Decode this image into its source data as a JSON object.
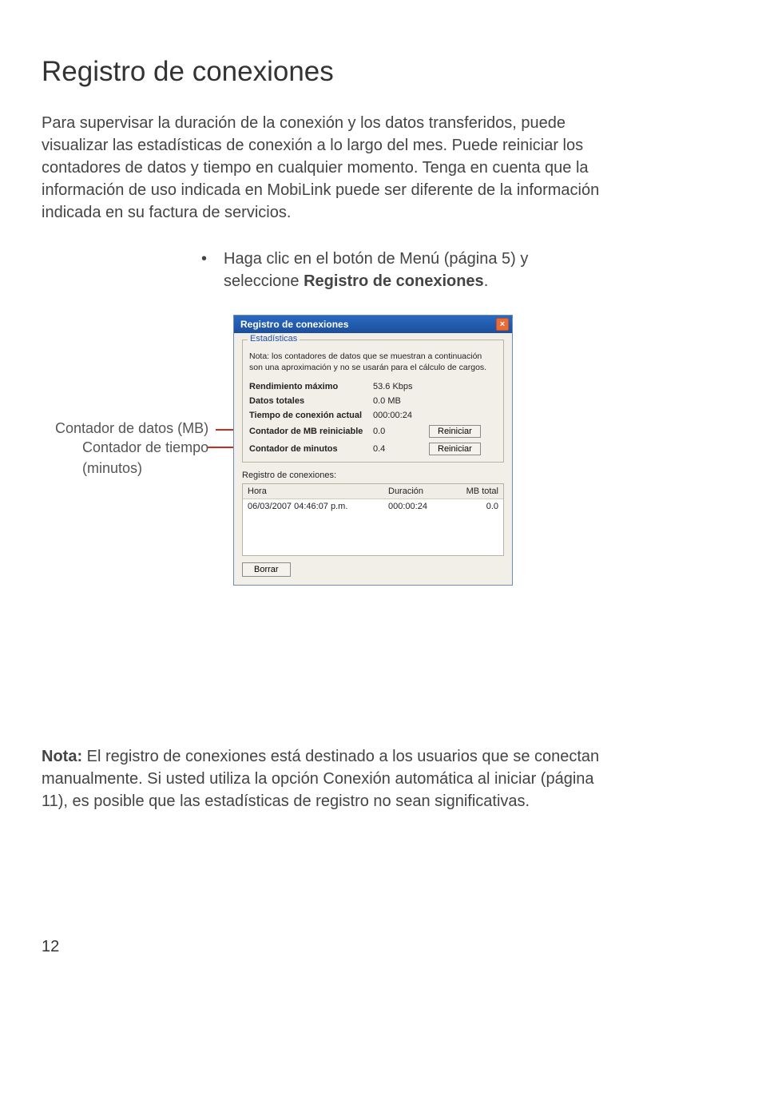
{
  "page": {
    "title": "Registro de conexiones",
    "intro": "Para supervisar la duración de la conexión y los datos transferidos, puede visualizar las estadísticas de conexión a lo largo del mes. Puede reiniciar los contadores de datos y tiempo en cualquier momento. Tenga en cuenta que la información de uso indicada en MobiLink puede ser diferente de la información indicada en su factura de servicios.",
    "bullet_prefix": "Haga clic en el botón de Menú (página 5) y seleccione ",
    "bullet_bold": "Registro de conexiones",
    "bullet_suffix": ".",
    "callout1": "Contador de datos (MB)",
    "callout2": "Contador de tiempo",
    "callout3": "(minutos)",
    "nota_label": "Nota:",
    "nota_text": " El registro de conexiones está destinado a los usuarios que se conectan manualmente. Si usted utiliza la opción Conexión automática al iniciar (página 11), es posible que las estadísticas de registro no sean significativas.",
    "page_number": "12"
  },
  "dialog": {
    "title": "Registro de conexiones",
    "close": "×",
    "group_legend": "Estadísticas",
    "note1": "Nota: los contadores de datos que se muestran a continuación",
    "note2": "son una aproximación y no se usarán para el cálculo de cargos.",
    "rows": {
      "r1_label": "Rendimiento máximo",
      "r1_value": "53.6 Kbps",
      "r2_label": "Datos totales",
      "r2_value": "0.0 MB",
      "r3_label": "Tiempo de conexión actual",
      "r3_value": "000:00:24",
      "r4_label": "Contador de MB reiniciable",
      "r4_value": "0.0",
      "r5_label": "Contador de minutos",
      "r5_value": "0.4"
    },
    "btn_reset": "Reiniciar",
    "log_label": "Registro de conexiones:",
    "cols": {
      "hora": "Hora",
      "dur": "Duración",
      "mb": "MB total"
    },
    "entry": {
      "hora": "06/03/2007 04:46:07 p.m.",
      "dur": "000:00:24",
      "mb": "0.0"
    },
    "btn_borrar": "Borrar"
  }
}
